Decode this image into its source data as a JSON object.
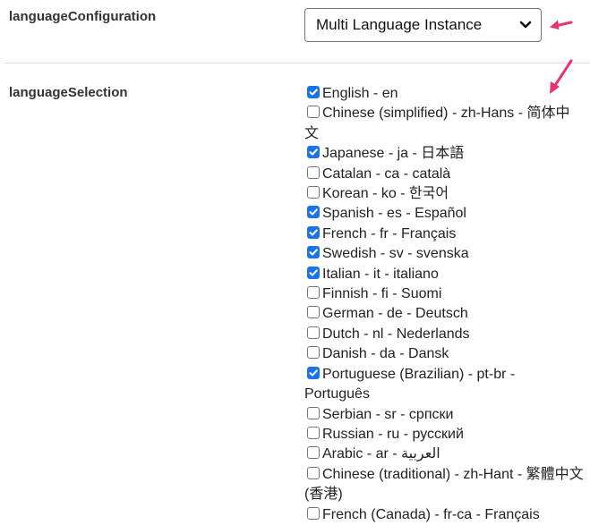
{
  "language_configuration": {
    "label": "languageConfiguration",
    "selected": "Multi Language Instance"
  },
  "language_selection": {
    "label": "languageSelection",
    "items": [
      {
        "label": "English - en",
        "checked": true
      },
      {
        "label": "Chinese (simplified) - zh-Hans - 简体中文",
        "checked": false
      },
      {
        "label": "Japanese - ja - 日本語",
        "checked": true
      },
      {
        "label": "Catalan - ca - català",
        "checked": false
      },
      {
        "label": "Korean - ko - 한국어",
        "checked": false
      },
      {
        "label": "Spanish - es - Español",
        "checked": true
      },
      {
        "label": "French - fr - Français",
        "checked": true
      },
      {
        "label": "Swedish - sv - svenska",
        "checked": true
      },
      {
        "label": "Italian - it - italiano",
        "checked": true
      },
      {
        "label": "Finnish - fi - Suomi",
        "checked": false
      },
      {
        "label": "German - de - Deutsch",
        "checked": false
      },
      {
        "label": "Dutch - nl - Nederlands",
        "checked": false
      },
      {
        "label": "Danish - da - Dansk",
        "checked": false
      },
      {
        "label": "Portuguese (Brazilian) - pt-br - Português",
        "checked": true
      },
      {
        "label": "Serbian - sr - српски",
        "checked": false
      },
      {
        "label": "Russian - ru - русский",
        "checked": false
      },
      {
        "label": "Arabic - ar - العربية",
        "checked": false
      },
      {
        "label": "Chinese (traditional) - zh-Hant - 繁體中文 (香港)",
        "checked": false
      },
      {
        "label": "French (Canada) - fr-ca - Français",
        "checked": false
      }
    ]
  },
  "colors": {
    "arrow": "#e8336f",
    "checkbox_checked": "#1a73e8"
  },
  "icons": {
    "select_chevron": "chevron-down-icon",
    "annotation": "arrow-icon"
  }
}
